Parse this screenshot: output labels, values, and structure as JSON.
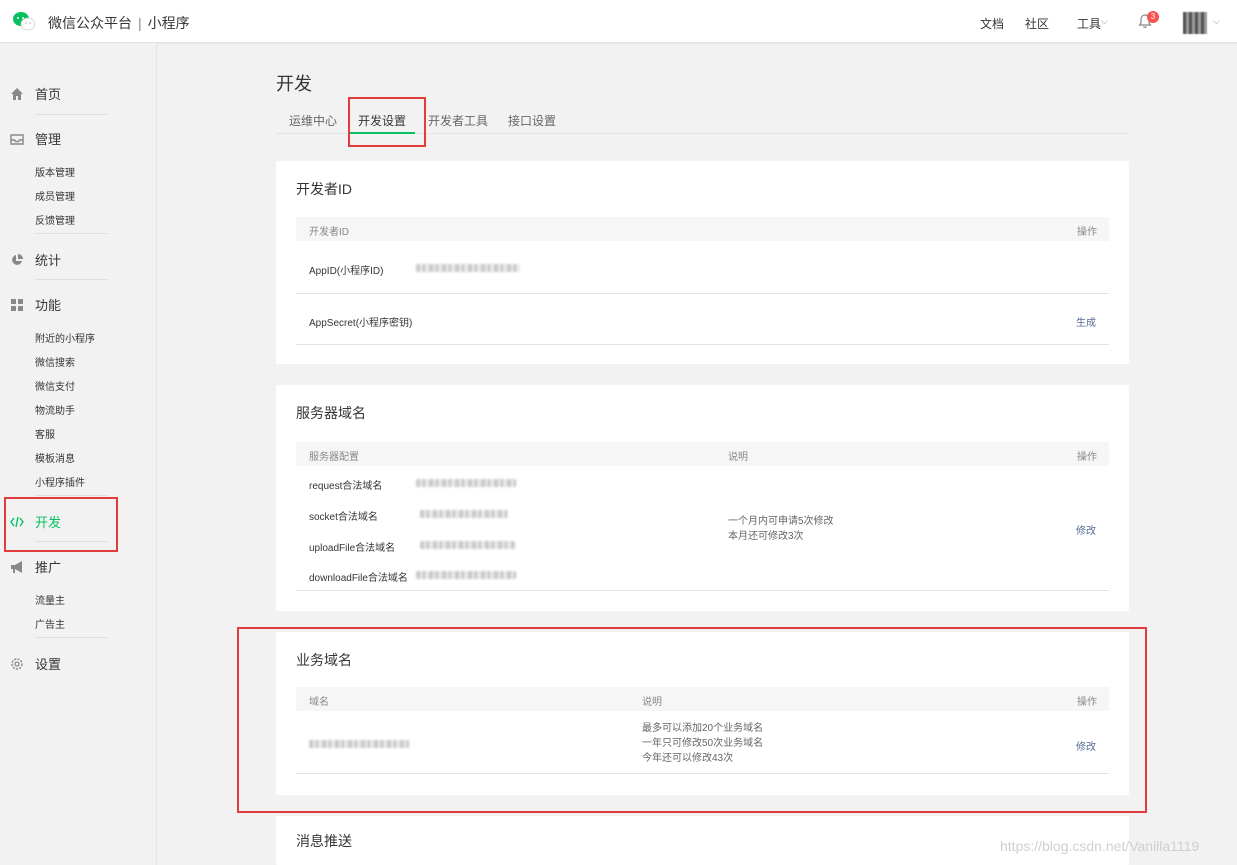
{
  "header": {
    "brand_name": "微信公众平台",
    "brand_sep": "|",
    "brand_product": "小程序",
    "links": [
      "文档",
      "社区",
      "工具"
    ],
    "notification_count": "3"
  },
  "sidebar": {
    "home": "首页",
    "manage": "管理",
    "manage_items": [
      "版本管理",
      "成员管理",
      "反馈管理"
    ],
    "stats": "统计",
    "features": "功能",
    "feature_items": [
      "附近的小程序",
      "微信搜索",
      "微信支付",
      "物流助手",
      "客服",
      "模板消息",
      "小程序插件"
    ],
    "develop": "开发",
    "promote": "推广",
    "promote_items": [
      "流量主",
      "广告主"
    ],
    "settings": "设置"
  },
  "main": {
    "title": "开发",
    "tabs": [
      "运维中心",
      "开发设置",
      "开发者工具",
      "接口设置"
    ],
    "active_tab": "开发设置"
  },
  "developer_id": {
    "title": "开发者ID",
    "col_id": "开发者ID",
    "col_op": "操作",
    "appid_label": "AppID(小程序ID)",
    "secret_label": "AppSecret(小程序密钥)",
    "generate": "生成"
  },
  "server_domain": {
    "title": "服务器域名",
    "col_config": "服务器配置",
    "col_desc": "说明",
    "col_op": "操作",
    "rows": [
      "request合法域名",
      "socket合法域名",
      "uploadFile合法域名",
      "downloadFile合法域名"
    ],
    "desc_lines": [
      "一个月内可申请5次修改",
      "本月还可修改3次"
    ],
    "modify": "修改"
  },
  "business_domain": {
    "title": "业务域名",
    "col_domain": "域名",
    "col_desc": "说明",
    "col_op": "操作",
    "desc_lines": [
      "最多可以添加20个业务域名",
      "一年只可修改50次业务域名",
      "今年还可以修改43次"
    ],
    "modify": "修改"
  },
  "message_push": {
    "title": "消息推送"
  },
  "watermark": "https://blog.csdn.net/Vanilla1119",
  "colors": {
    "accent_green": "#07c160",
    "link_blue": "#576b95",
    "highlight_red": "#e23c3c",
    "badge_red": "#fa5151"
  }
}
